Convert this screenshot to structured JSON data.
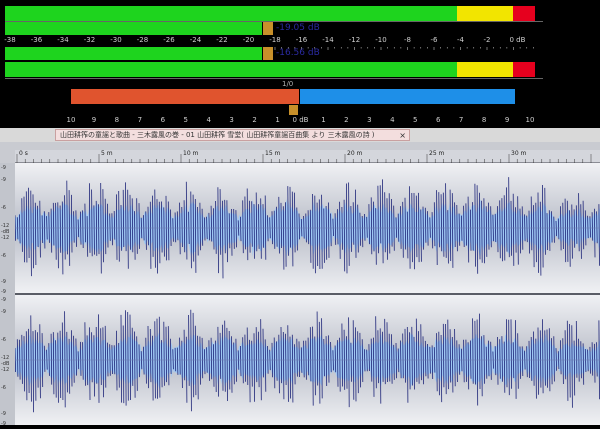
{
  "meters": {
    "left_readout": "-19.05 dB",
    "right_readout": "-16.56 dB",
    "db_scale": [
      "-38",
      "-36",
      "-34",
      "-32",
      "-30",
      "-28",
      "-26",
      "-24",
      "-22",
      "-20",
      "-18",
      "-16",
      "-14",
      "-12",
      "-10",
      "-8",
      "-6",
      "-4",
      "-2",
      "0 dB"
    ],
    "colors": {
      "green": "#1ed41e",
      "yellow": "#f2e500",
      "red": "#e6001e",
      "marker": "#c8902a"
    }
  },
  "correlation": {
    "scale": [
      "10",
      "9",
      "8",
      "7",
      "6",
      "5",
      "4",
      "3",
      "2",
      "1",
      "0 dB",
      "1",
      "2",
      "3",
      "4",
      "5",
      "6",
      "7",
      "8",
      "9",
      "10"
    ],
    "readout": "1/0",
    "colors": {
      "left": "#e0542e",
      "right": "#1e8fe8"
    }
  },
  "tab": {
    "title": "山田耕筰の童謡と歌曲 - 三木露風の巻 - 01 山田耕筰 雪堂( 山田耕筰童謡百曲集 より 三木露風の詩 )",
    "close": "×"
  },
  "timeline": {
    "labels": [
      "0 s",
      "5 m",
      "10 m",
      "15 m",
      "20 m",
      "25 m",
      "30 m"
    ]
  },
  "amplitude": {
    "labels": [
      "-9",
      "-9",
      "-6",
      "-12",
      "-dB",
      "-12",
      "-6",
      "-9",
      "-9"
    ]
  }
}
